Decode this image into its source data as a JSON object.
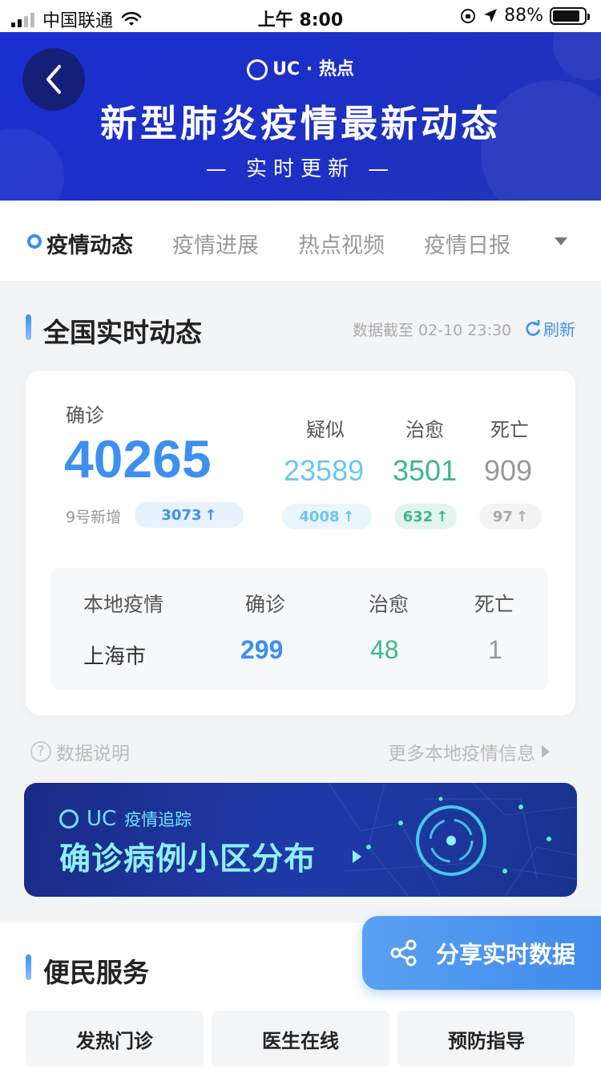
{
  "status_bar": {
    "carrier": "中国联通",
    "time": "上午 8:00",
    "battery": "88%"
  },
  "banner": {
    "brand": "UC · 热点",
    "title": "新型肺炎疫情最新动态",
    "subtitle": "— 实时更新 —"
  },
  "tabs": [
    {
      "label": "疫情动态"
    },
    {
      "label": "疫情进展"
    },
    {
      "label": "热点视频"
    },
    {
      "label": "疫情日报"
    }
  ],
  "national": {
    "title": "全国实时动态",
    "data_time": "数据截至 02-10 23:30",
    "refresh_label": "刷新",
    "confirmed_label": "确诊",
    "confirmed_value": "40265",
    "new_label": "9号新增",
    "confirmed_new": "3073",
    "suspected_label": "疑似",
    "suspected_value": "23589",
    "suspected_new": "4008",
    "cured_label": "治愈",
    "cured_value": "3501",
    "cured_new": "632",
    "death_label": "死亡",
    "death_value": "909",
    "death_new": "97",
    "arrow": "↑"
  },
  "local": {
    "header_label": "本地疫情",
    "confirmed_label": "确诊",
    "cured_label": "治愈",
    "death_label": "死亡",
    "city": "上海市",
    "confirmed": "299",
    "cured": "48",
    "death": "1"
  },
  "links": {
    "data_note": "数据说明",
    "more_local": "更多本地疫情信息"
  },
  "promo": {
    "brand": "UC",
    "tag": "疫情追踪",
    "title": "确诊病例小区分布"
  },
  "services": {
    "title": "便民服务",
    "items": [
      {
        "label": "发热门诊"
      },
      {
        "label": "医生在线"
      },
      {
        "label": "预防指导"
      }
    ]
  },
  "share_label": "分享实时数据",
  "colors": {
    "accent": "#3d8ff0",
    "suspected": "#6cc6f5",
    "cured": "#3fb68d",
    "death": "#999999",
    "banner": "#1a2fd1"
  },
  "icons": [
    "back-arrow-icon",
    "uc-logo-icon",
    "refresh-icon",
    "dropdown-icon",
    "question-icon",
    "share-icon",
    "chevron-right-icon"
  ]
}
